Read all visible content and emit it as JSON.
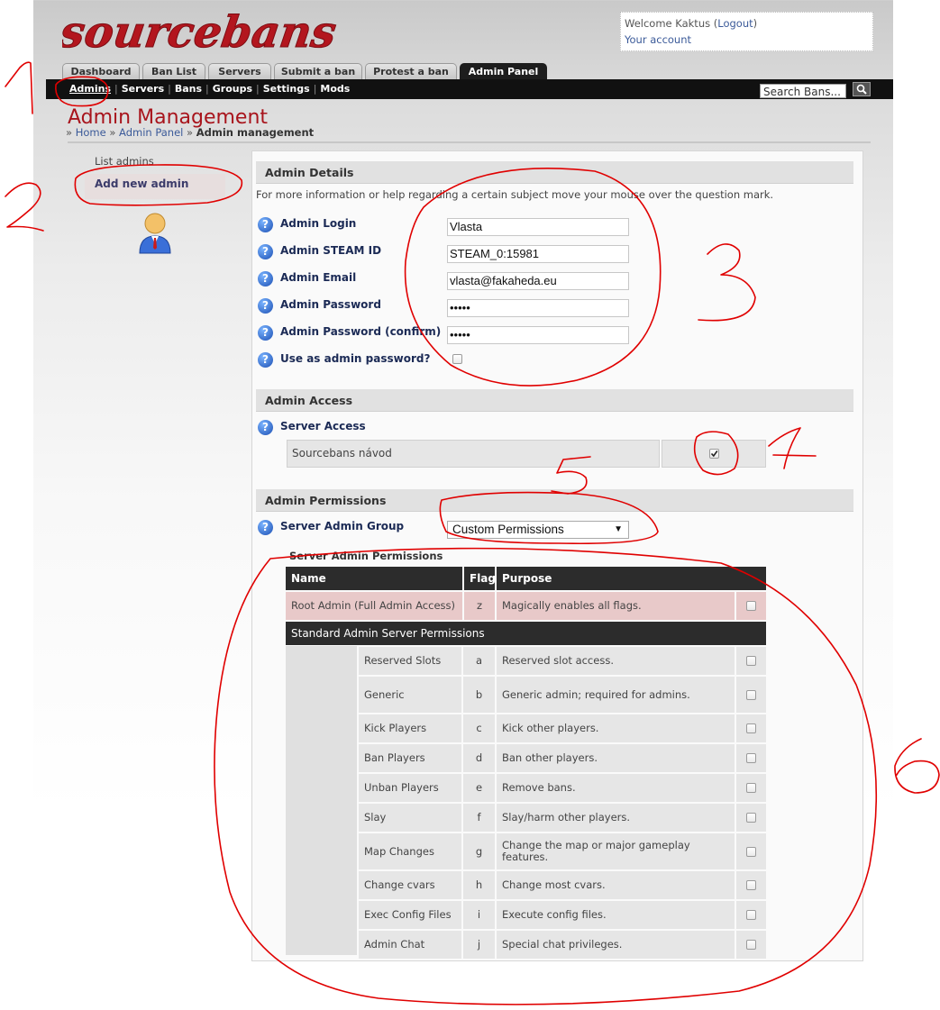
{
  "logo": {
    "text": "sourcebans"
  },
  "header": {
    "welcome_prefix": "Welcome Kaktus (",
    "logout": "Logout",
    "welcome_suffix": ")",
    "account": "Your account"
  },
  "tabs": [
    "Dashboard",
    "Ban List",
    "Servers",
    "Submit a ban",
    "Protest a ban",
    "Admin Panel"
  ],
  "subnav": [
    "Admins",
    "Servers",
    "Bans",
    "Groups",
    "Settings",
    "Mods"
  ],
  "search": {
    "text": "Search Bans..."
  },
  "page": {
    "title": "Admin Management",
    "breadcrumb": {
      "prefix": "»",
      "home": "Home",
      "sep": "»",
      "panel": "Admin Panel",
      "current": "Admin management"
    }
  },
  "sidebar": {
    "list": "List admins",
    "add": "Add new admin"
  },
  "details": {
    "header": "Admin Details",
    "help": "For more information or help regarding a certain subject move your mouse over the question mark.",
    "fields": [
      {
        "label": "Admin Login",
        "value": "Vlasta"
      },
      {
        "label": "Admin STEAM ID",
        "value": "STEAM_0:15981"
      },
      {
        "label": "Admin Email",
        "value": "vlasta@fakaheda.eu"
      },
      {
        "label": "Admin Password",
        "value": "•••••"
      },
      {
        "label": "Admin Password (confirm)",
        "value": "•••••"
      }
    ],
    "use_admin_pw": "Use as admin password?"
  },
  "access": {
    "header": "Admin Access",
    "label": "Server Access",
    "server": "Sourcebans návod",
    "checked": true
  },
  "permissions": {
    "header": "Admin Permissions",
    "group_label": "Server Admin Group",
    "group_value": "Custom Permissions",
    "table_title": "Server Admin Permissions",
    "columns": [
      "Name",
      "Flag",
      "Purpose"
    ],
    "root": {
      "name": "Root Admin (Full Admin Access)",
      "flag": "z",
      "purpose": "Magically enables all flags."
    },
    "subheader": "Standard Admin Server Permissions",
    "rows": [
      {
        "name": "Reserved Slots",
        "flag": "a",
        "purpose": "Reserved slot access."
      },
      {
        "name": "Generic",
        "flag": "b",
        "purpose": "Generic admin; required for admins."
      },
      {
        "name": "Kick Players",
        "flag": "c",
        "purpose": "Kick other players."
      },
      {
        "name": "Ban Players",
        "flag": "d",
        "purpose": "Ban other players."
      },
      {
        "name": "Unban Players",
        "flag": "e",
        "purpose": "Remove bans."
      },
      {
        "name": "Slay",
        "flag": "f",
        "purpose": "Slay/harm other players."
      },
      {
        "name": "Map Changes",
        "flag": "g",
        "purpose": "Change the map or major gameplay features."
      },
      {
        "name": "Change cvars",
        "flag": "h",
        "purpose": "Change most cvars."
      },
      {
        "name": "Exec Config Files",
        "flag": "i",
        "purpose": "Execute config files."
      },
      {
        "name": "Admin Chat",
        "flag": "j",
        "purpose": "Special chat privileges."
      }
    ]
  },
  "annotations": [
    "1",
    "2",
    "3",
    "4",
    "5",
    "6"
  ],
  "colors": {
    "brand": "#a8141c",
    "navbar": "#111111",
    "link": "#3b5a99",
    "annotation": "#e00000"
  }
}
